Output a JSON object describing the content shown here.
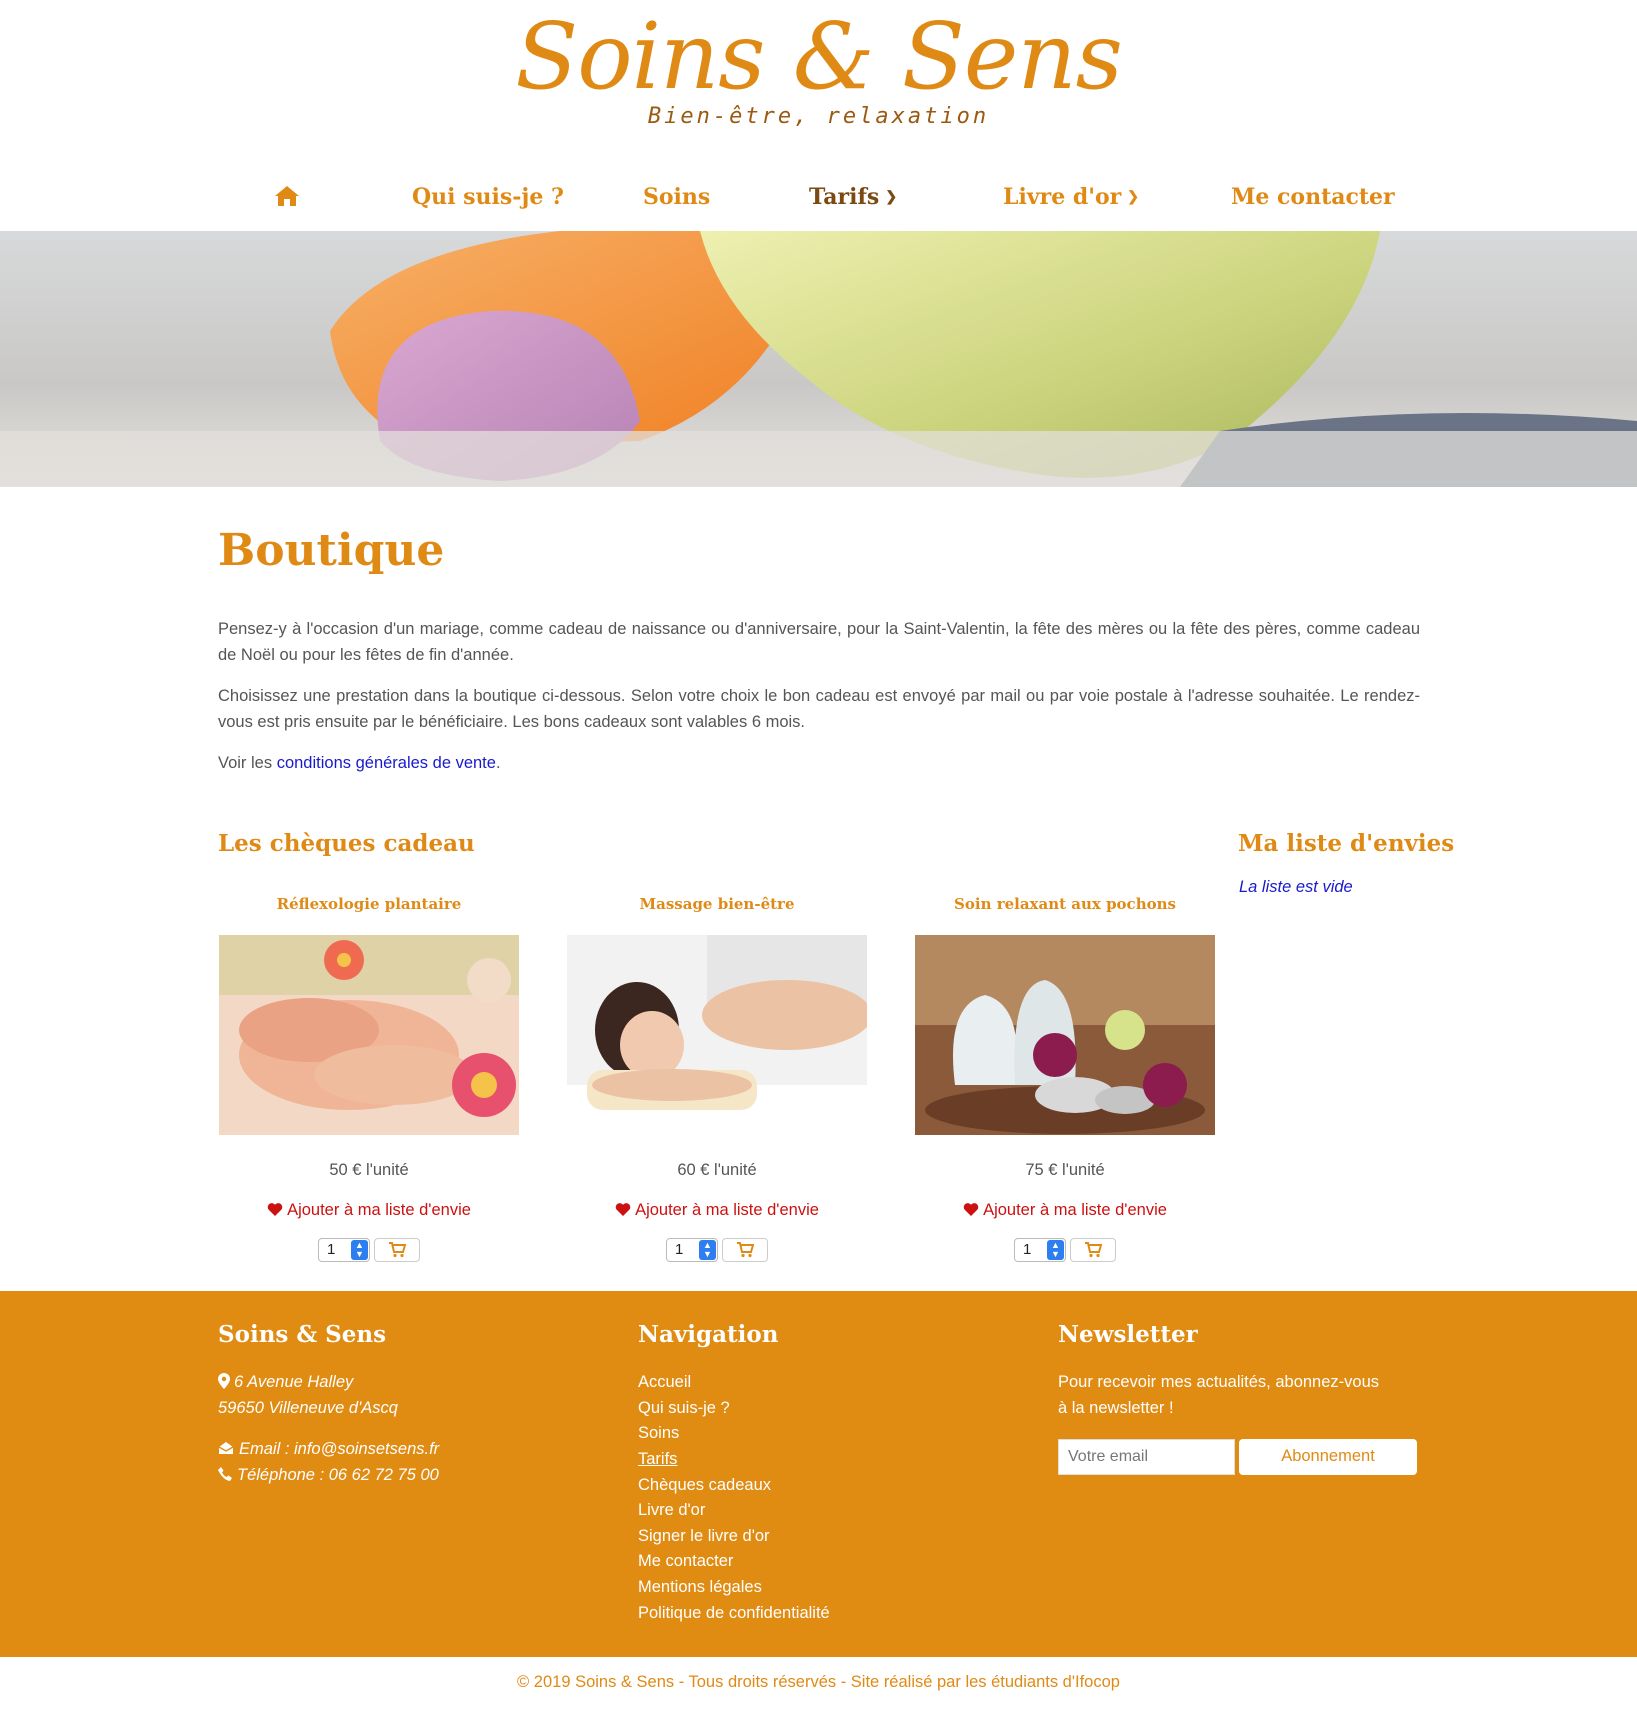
{
  "brand": {
    "title": "Soins & Sens",
    "subtitle": "Bien-être, relaxation",
    "accent_color": "#e08a16"
  },
  "nav": {
    "home_icon": "home-icon",
    "items": [
      {
        "label": "Qui suis-je ?"
      },
      {
        "label": "Soins"
      },
      {
        "label": "Tarifs",
        "has_dropdown": true,
        "active": true
      },
      {
        "label": "Livre d'or",
        "has_dropdown": true
      },
      {
        "label": "Me contacter"
      }
    ]
  },
  "main": {
    "title": "Boutique",
    "para1": "Pensez-y à l'occasion d'un mariage, comme cadeau de naissance ou d'anniversaire, pour la Saint-Valentin, la fête des mères ou la fête des pères, comme cadeau de Noël ou pour les fêtes de fin d'année.",
    "para2": "Choisissez une prestation dans la boutique ci-dessous. Selon votre choix le bon cadeau est envoyé par mail ou par voie postale à l'adresse souhaitée. Le rendez-vous est pris ensuite par le bénéficiaire. Les bons cadeaux sont valables 6 mois.",
    "cgv_prefix": "Voir les ",
    "cgv_link": "conditions générales de vente",
    "cgv_suffix": ".",
    "gift_section_title": "Les chèques cadeau",
    "wishlist_title": "Ma liste d'envies",
    "wishlist_empty": "La liste est vide",
    "products": [
      {
        "title": "Réflexologie plantaire",
        "price": "50 € l'unité",
        "wish_label": "Ajouter à ma liste d'envie",
        "qty": "1"
      },
      {
        "title": "Massage bien-être",
        "price": "60 € l'unité",
        "wish_label": "Ajouter à ma liste d'envie",
        "qty": "1"
      },
      {
        "title": "Soin relaxant aux pochons",
        "price": "75 € l'unité",
        "wish_label": "Ajouter à ma liste d'envie",
        "qty": "1"
      }
    ]
  },
  "footer": {
    "bg_color": "#e08b12",
    "col1_title": "Soins & Sens",
    "address1": "6 Avenue Halley",
    "address2": "59650 Villeneuve d'Ascq",
    "email": "Email : info@soinsetsens.fr",
    "phone": "Téléphone : 06 62 72 75 00",
    "col2_title": "Navigation",
    "nav_links": [
      "Accueil",
      "Qui suis-je ?",
      "Soins",
      "Tarifs",
      "Chèques cadeaux",
      "Livre d'or",
      "Signer le livre d'or",
      "Me contacter",
      "Mentions légales",
      "Politique de confidentialité"
    ],
    "col3_title": "Newsletter",
    "newsletter_text1": "Pour recevoir mes actualités, abonnez-vous",
    "newsletter_text2": "à la newsletter !",
    "email_placeholder": "Votre email",
    "subscribe_label": "Abonnement"
  },
  "copyright": "© 2019 Soins & Sens - Tous droits réservés - Site réalisé par les étudiants d'Ifocop"
}
